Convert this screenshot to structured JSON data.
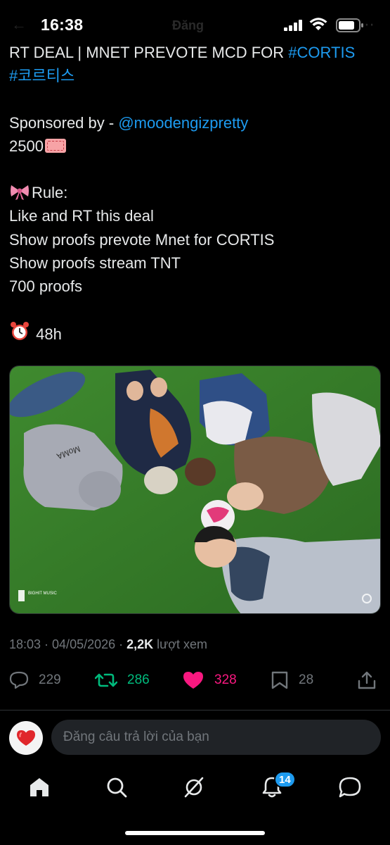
{
  "status_bar": {
    "time": "16:38",
    "header_ghost": "Đăng"
  },
  "tweet": {
    "title_plain": "RT DEAL | MNET PREVOTE MCD FOR ",
    "hashtag_1": "#CORTIS",
    "hashtag_2": "#코르티스",
    "sponsor_prefix": "Sponsored by - ",
    "sponsor_handle": "@moodengizpretty",
    "amount": "2500",
    "rule_heading": "Rule:",
    "rules": [
      "Like and RT this deal",
      "Show proofs prevote Mnet for CORTIS",
      "Show proofs stream TNT",
      "700 proofs"
    ],
    "duration": "48h",
    "image_watermark": "BIGHIT MUSIC",
    "hoodie_text": "MoMA"
  },
  "meta": {
    "timestamp": "18:03 · 04/05/2026 · ",
    "views_count": "2,2K",
    "views_label": " lượt xem"
  },
  "actions": {
    "replies": "229",
    "retweets": "286",
    "likes": "328",
    "bookmarks": "28"
  },
  "composer": {
    "placeholder": "Đăng câu trả lời của bạn"
  },
  "nav": {
    "notifications_badge": "14"
  },
  "colors": {
    "link": "#1d9bf0",
    "retweet_active": "#00ba7c",
    "like_active": "#f91880",
    "muted": "#71767b",
    "background": "#000000"
  }
}
